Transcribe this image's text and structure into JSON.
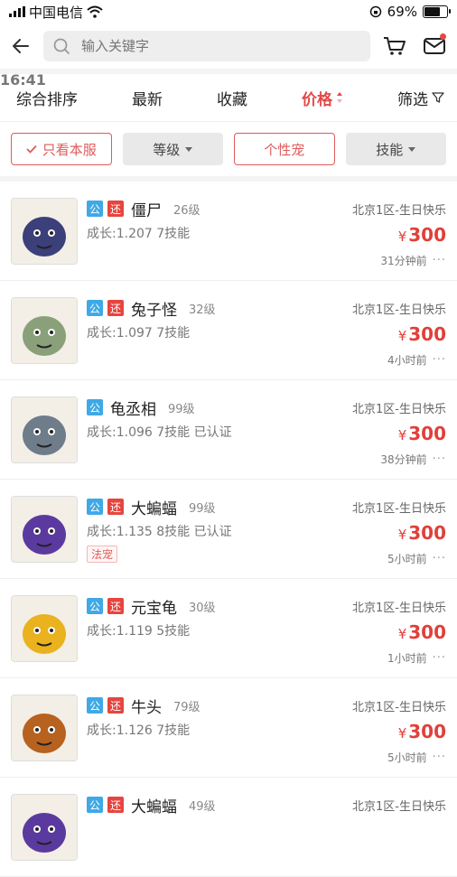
{
  "status": {
    "carrier": "中国电信",
    "time": "16:41",
    "battery": "69%"
  },
  "search": {
    "placeholder": "输入关键字"
  },
  "tabs": [
    {
      "label": "综合排序"
    },
    {
      "label": "最新"
    },
    {
      "label": "收藏"
    },
    {
      "label": "价格"
    },
    {
      "label": "筛选"
    }
  ],
  "filters": {
    "own_server": "只看本服",
    "grade": "等级",
    "personal": "个性宠",
    "skills": "技能"
  },
  "badges": {
    "pub": "公",
    "ret": "还"
  },
  "currency": "¥",
  "items": [
    {
      "name": "僵尸",
      "level": "26级",
      "server": "北京1区-生日快乐",
      "detail": "成长:1.207 7技能",
      "price": "300",
      "time": "31分钟前",
      "ret": true,
      "tag": "",
      "art_color": "#3b3f7a"
    },
    {
      "name": "兔子怪",
      "level": "32级",
      "server": "北京1区-生日快乐",
      "detail": "成长:1.097 7技能",
      "price": "300",
      "time": "4小时前",
      "ret": true,
      "tag": "",
      "art_color": "#8aa07a"
    },
    {
      "name": "龟丞相",
      "level": "99级",
      "server": "北京1区-生日快乐",
      "detail": "成长:1.096 7技能 已认证",
      "price": "300",
      "time": "38分钟前",
      "ret": false,
      "tag": "",
      "art_color": "#6f7c8a"
    },
    {
      "name": "大蝙蝠",
      "level": "99级",
      "server": "北京1区-生日快乐",
      "detail": "成长:1.135 8技能 已认证",
      "price": "300",
      "time": "5小时前",
      "ret": true,
      "tag": "法宠",
      "art_color": "#5b3aa0"
    },
    {
      "name": "元宝龟",
      "level": "30级",
      "server": "北京1区-生日快乐",
      "detail": "成长:1.119 5技能",
      "price": "300",
      "time": "1小时前",
      "ret": true,
      "tag": "",
      "art_color": "#e9b21e"
    },
    {
      "name": "牛头",
      "level": "79级",
      "server": "北京1区-生日快乐",
      "detail": "成长:1.126 7技能",
      "price": "300",
      "time": "5小时前",
      "ret": true,
      "tag": "",
      "art_color": "#b8621f"
    },
    {
      "name": "大蝙蝠",
      "level": "49级",
      "server": "北京1区-生日快乐",
      "detail": "",
      "price": "",
      "time": "",
      "ret": true,
      "tag": "",
      "art_color": "#5b3aa0"
    }
  ],
  "colors": {
    "accent": "#e04a4a",
    "pub_badge": "#3ea9e6",
    "ret_badge": "#e5463f"
  }
}
